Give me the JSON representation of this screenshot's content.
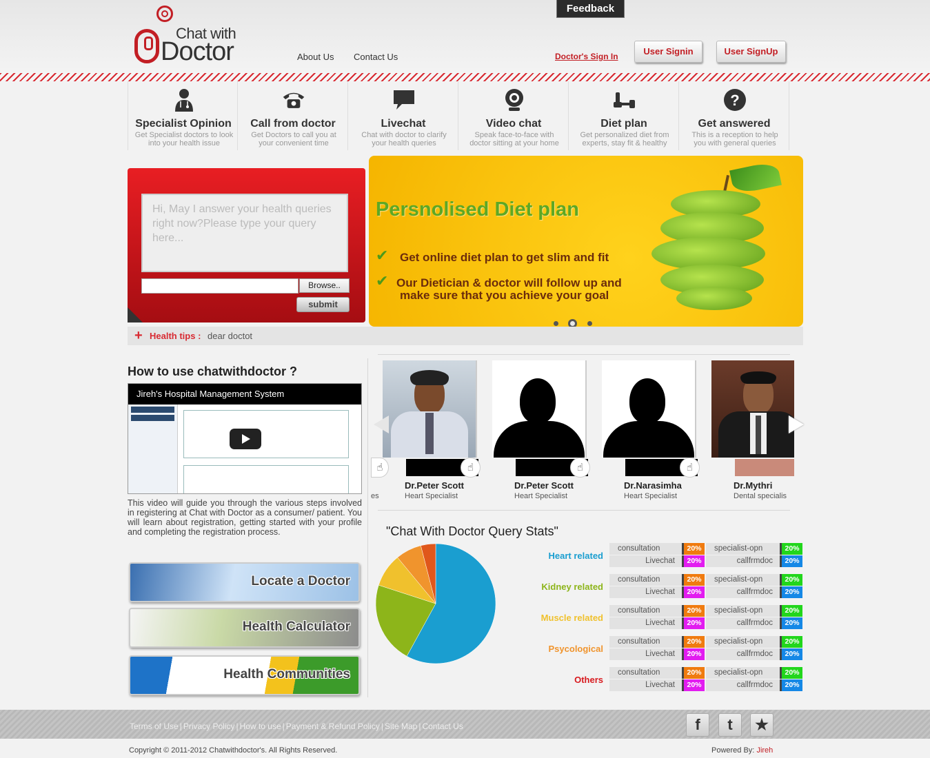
{
  "header": {
    "feedback": "Feedback",
    "logo_line1": "Chat with",
    "logo_line2": "Doctor",
    "nav": [
      "About Us",
      "Contact Us"
    ],
    "doctor_signin": "Doctor's Sign In",
    "user_signin": "User Signin",
    "user_signup": "User SignUp"
  },
  "services": [
    {
      "title": "Specialist Opinion",
      "desc": "Get Specialist doctors to look into your health issue",
      "icon": "doctor-icon"
    },
    {
      "title": "Call from doctor",
      "desc": "Get Doctors to call you at your convenient time",
      "icon": "phone-icon"
    },
    {
      "title": "Livechat",
      "desc": "Chat with doctor to clarify your health queries",
      "icon": "chat-bubble-icon"
    },
    {
      "title": "Video chat",
      "desc": "Speak face-to-face with doctor sitting at your home",
      "icon": "webcam-icon"
    },
    {
      "title": "Diet plan",
      "desc": "Get personalized diet from experts, stay fit & healthy",
      "icon": "dumbbell-icon"
    },
    {
      "title": "Get answered",
      "desc": "This is a reception to help you with general queries",
      "icon": "question-icon"
    }
  ],
  "query": {
    "placeholder": "Hi, May I answer your health queries right now?Please type your query here...",
    "browse": "Browse..",
    "submit": "submit"
  },
  "banner": {
    "title": "Persnolised Diet plan",
    "point1": "Get online diet plan to get slim and fit",
    "point2a": "Our Dietician & doctor will follow up and",
    "point2b": "make sure that you achieve your goal",
    "slide_count": 3,
    "active_slide": 2
  },
  "tips": {
    "label": "Health tips :",
    "text": "dear doctot"
  },
  "howto": {
    "title": "How to use chatwithdoctor ?",
    "video_title": "Jireh's Hospital Management System",
    "desc": "This video will guide you through the various steps involved in registering at Chat with Doctor as a consumer/ patient. You will learn about registration, getting started with your profile and completing the registration process."
  },
  "tools": [
    "Locate a Doctor",
    "Health Calculator",
    "Health Communities"
  ],
  "doctors": {
    "partial_prev_spec": "es",
    "list": [
      {
        "name": "Dr.Peter Scott",
        "spec": "Heart Specialist",
        "photo": "photo"
      },
      {
        "name": "Dr.Peter Scott",
        "spec": "Heart Specialist",
        "photo": "silhouette"
      },
      {
        "name": "Dr.Narasimha",
        "spec": "Heart Specialist",
        "photo": "silhouette"
      },
      {
        "name": "Dr.Mythri",
        "spec": "Dental specialis",
        "photo": "photo"
      }
    ]
  },
  "stats": {
    "title": "\"Chat With Doctor Query Stats\"",
    "colors": {
      "consultation": "#f07b0f",
      "specialist": "#22d61c",
      "livechat": "#e21cf0",
      "callfrmdoc": "#1588e6"
    },
    "categories": [
      {
        "name": "Heart related",
        "color": "#1a9ed0",
        "consultation": "20%",
        "specialist": "20%",
        "livechat": "20%",
        "callfrmdoc": "20%"
      },
      {
        "name": "Kidney related",
        "color": "#8db51a",
        "consultation": "20%",
        "specialist": "20%",
        "livechat": "20%",
        "callfrmdoc": "20%"
      },
      {
        "name": "Muscle related",
        "color": "#f0c12d",
        "consultation": "20%",
        "specialist": "20%",
        "livechat": "20%",
        "callfrmdoc": "20%"
      },
      {
        "name": "Psycological",
        "color": "#f0942d",
        "consultation": "20%",
        "specialist": "20%",
        "livechat": "20%",
        "callfrmdoc": "20%"
      },
      {
        "name": "Others",
        "color": "#d8191e",
        "consultation": "20%",
        "specialist": "20%",
        "livechat": "20%",
        "callfrmdoc": "20%"
      }
    ],
    "labels": {
      "consultation": "consultation",
      "specialist": "specialist-opn",
      "livechat": "Livechat",
      "callfrmdoc": "callfrmdoc"
    }
  },
  "chart_data": {
    "type": "pie",
    "title": "",
    "slices": [
      {
        "label": "Heart related",
        "value": 58,
        "color": "#1a9ed0"
      },
      {
        "label": "Kidney related",
        "value": 22,
        "color": "#8db51a"
      },
      {
        "label": "Muscle related",
        "value": 9,
        "color": "#f0c12d"
      },
      {
        "label": "Psycological",
        "value": 7,
        "color": "#f0942d"
      },
      {
        "label": "Others",
        "value": 4,
        "color": "#e0571b"
      }
    ]
  },
  "footer": {
    "links": [
      "Terms of Use",
      "Privacy Policy",
      "How to use",
      "Payment & Refund Policy",
      "Site Map",
      "Contact Us"
    ],
    "social": [
      "f",
      "t",
      "★"
    ],
    "copyright": "Copyright © 2011-2012 Chatwithdoctor's. All Rights Reserved.",
    "powered_label": "Powered By:",
    "powered_name": "Jireh"
  }
}
